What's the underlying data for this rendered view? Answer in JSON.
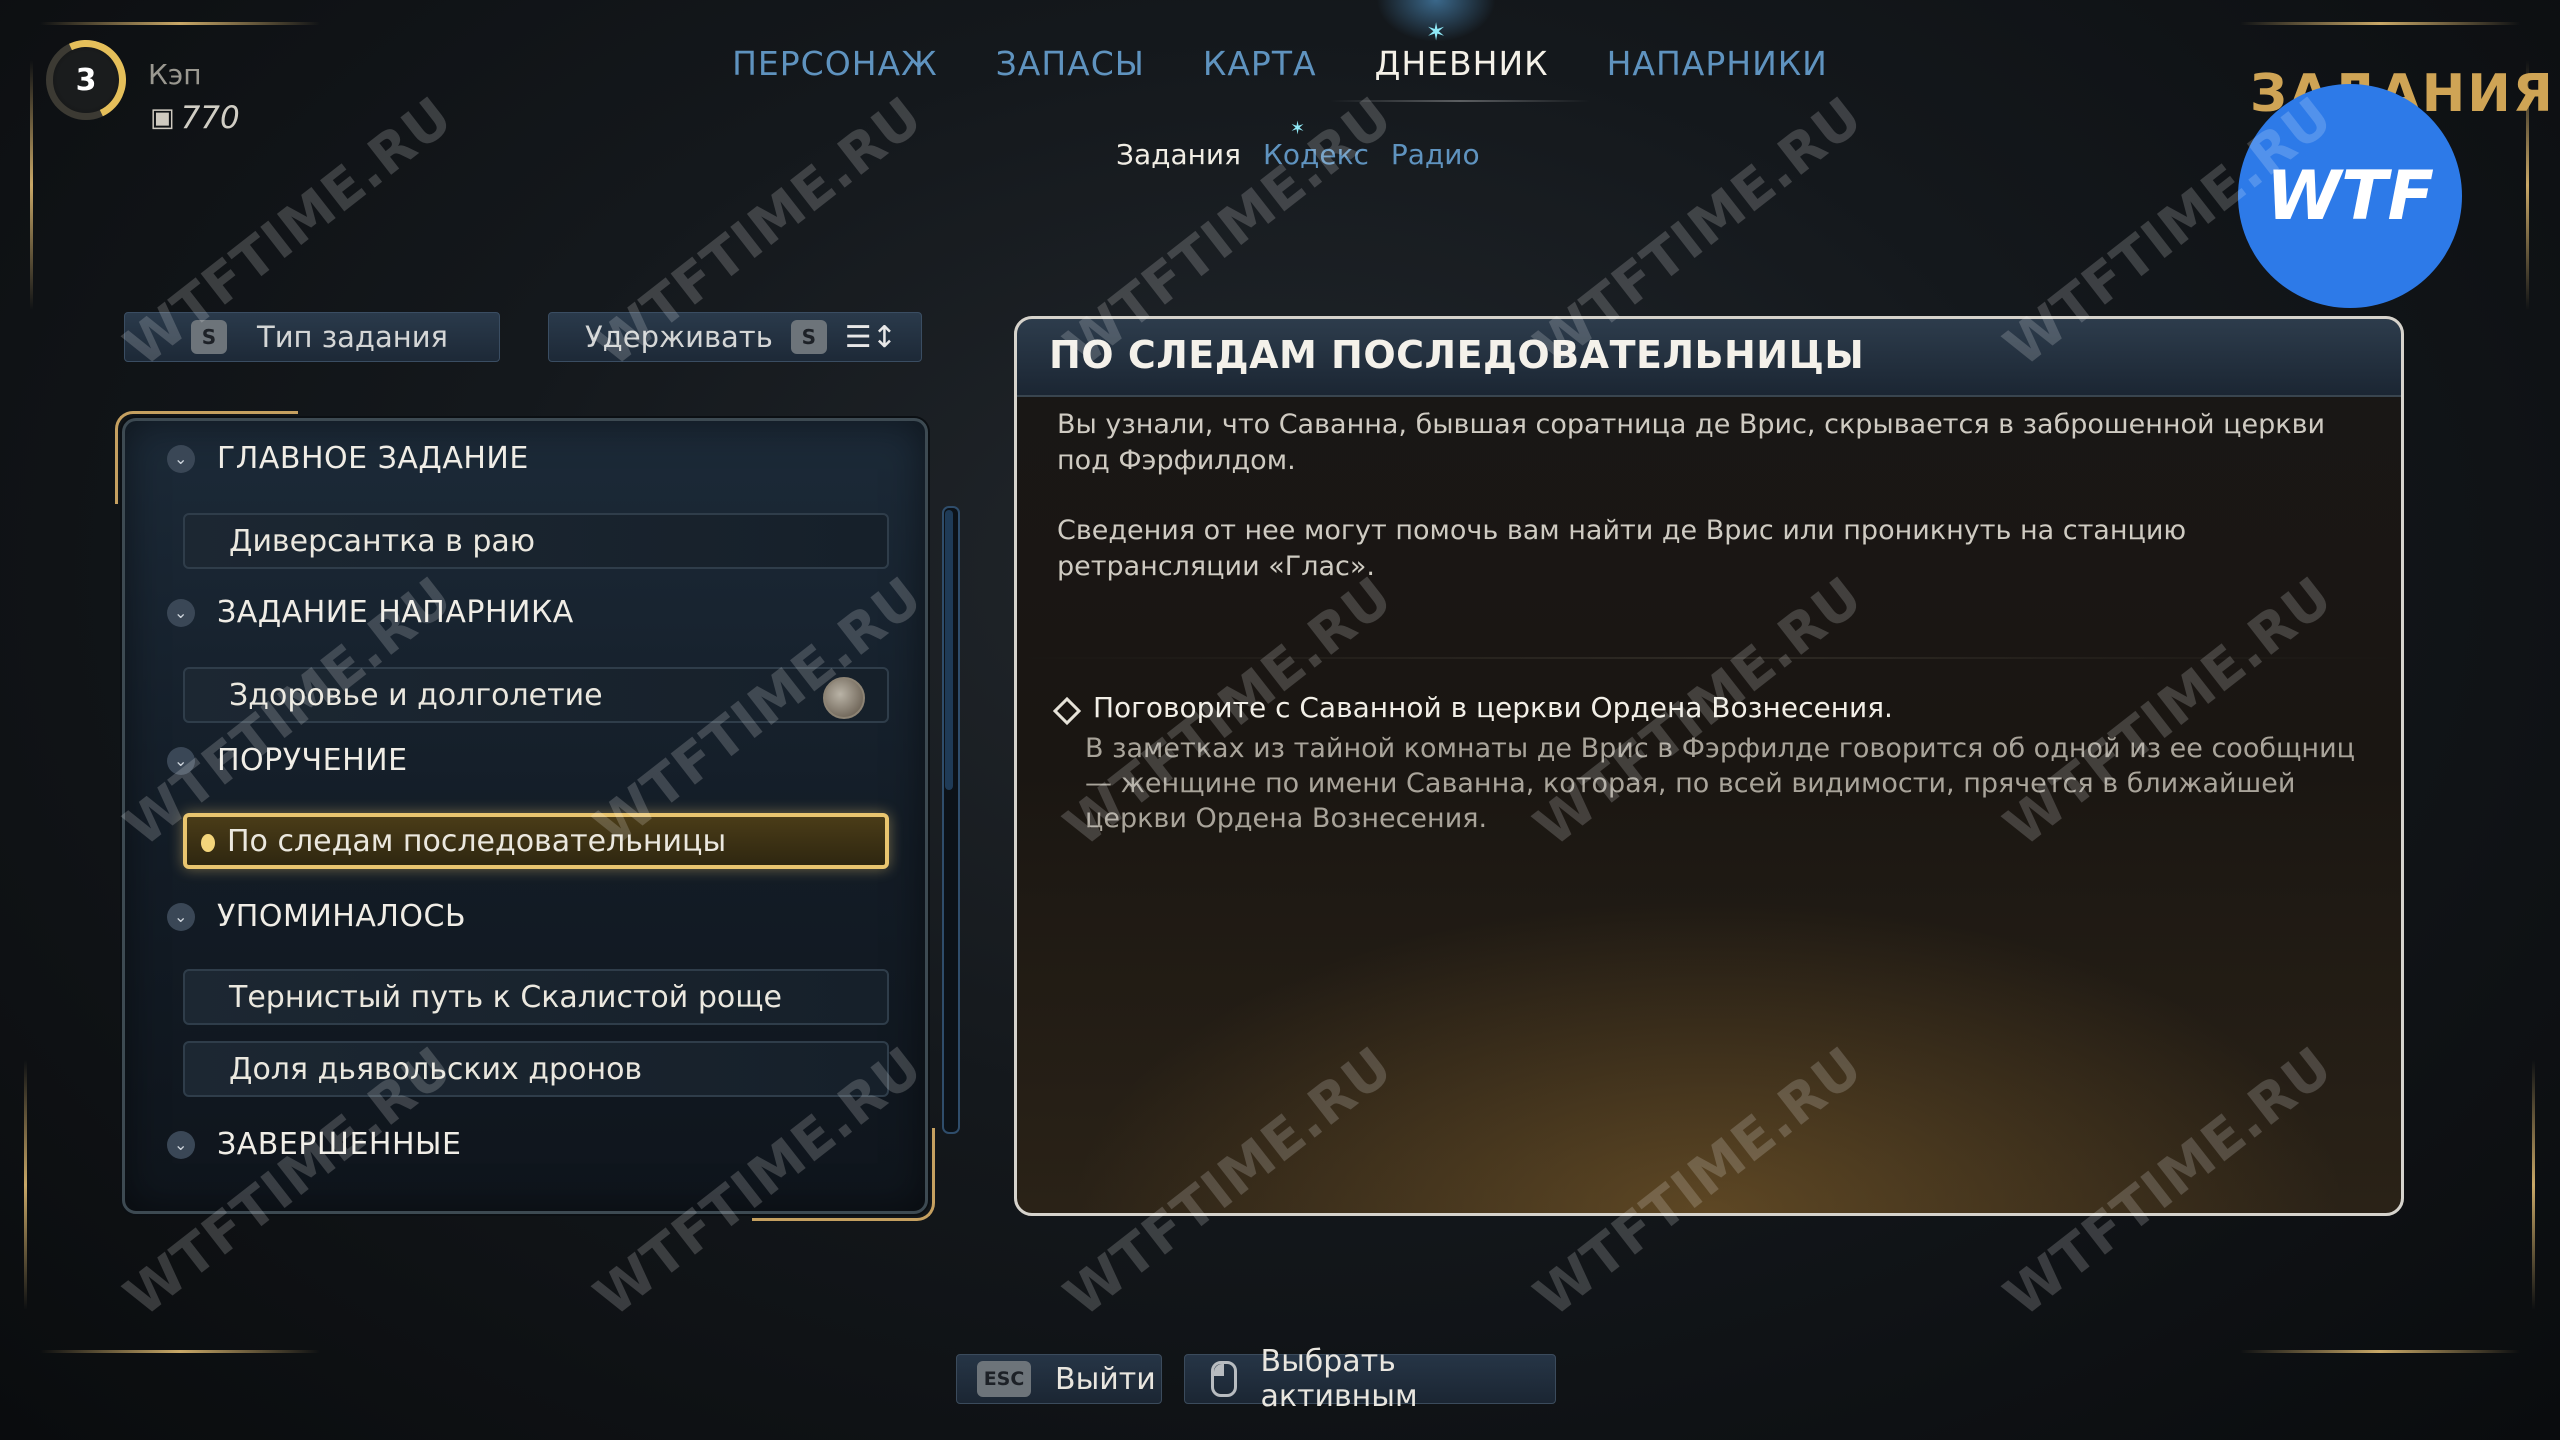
{
  "player": {
    "level": "3",
    "name": "Кэп",
    "currency_icon": "bits-icon",
    "currency": "770"
  },
  "nav": {
    "tabs": [
      {
        "label": "ПЕРСОНАЖ",
        "active": false
      },
      {
        "label": "ЗАПАСЫ",
        "active": false
      },
      {
        "label": "КАРТА",
        "active": false
      },
      {
        "label": "ДНЕВНИК",
        "active": true
      },
      {
        "label": "НАПАРНИКИ",
        "active": false
      }
    ],
    "subtabs": [
      {
        "label": "Задания",
        "active": true
      },
      {
        "label": "Кодекс",
        "active": false
      },
      {
        "label": "Радио",
        "active": false
      }
    ]
  },
  "section_title": "ЗАДАНИЯ",
  "logo": "WTF",
  "filters": {
    "type": {
      "key": "S",
      "label": "Тип задания"
    },
    "hold": {
      "label": "Удерживать",
      "key": "S",
      "icon": "sort-icon"
    }
  },
  "quest_list": {
    "categories": [
      {
        "label": "ГЛАВНОЕ ЗАДАНИЕ"
      },
      {
        "label": "ЗАДАНИЕ НАПАРНИКА"
      },
      {
        "label": "ПОРУЧЕНИЕ"
      },
      {
        "label": "УПОМИНАЛОСЬ"
      },
      {
        "label": "ЗАВЕРШЕННЫЕ"
      }
    ],
    "quests": [
      {
        "label": "Диверсантка в раю",
        "selected": false
      },
      {
        "label": "Здоровье и долголетие",
        "selected": false
      },
      {
        "label": "По следам последовательницы",
        "selected": true
      },
      {
        "label": "Тернистый путь к Скалистой роще",
        "selected": false
      },
      {
        "label": "Доля дьявольских дронов",
        "selected": false
      }
    ]
  },
  "detail": {
    "title": "ПО СЛЕДАМ ПОСЛЕДОВАТЕЛЬНИЦЫ",
    "description_1": "Вы узнали, что Саванна, бывшая соратница де Врис, скрывается в заброшенной церкви под Фэрфилдом.",
    "description_2": "Сведения от нее могут помочь вам найти де Врис или проникнуть на станцию ретрансляции «Глас».",
    "objective": "Поговорите с Саванной в церкви Ордена Вознесения.",
    "objective_note": "В заметках из тайной комнаты де Врис в Фэрфилде говорится об одной из ее сообщниц — женщине по имени Саванна, которая, по всей видимости, прячется в ближайшей церкви Ордена Вознесения."
  },
  "footer": {
    "exit": {
      "key": "ESC",
      "label": "Выйти"
    },
    "select_active": {
      "icon": "mouse-icon",
      "label": "Выбрать активным"
    }
  },
  "watermark": "WTFTIME.RU",
  "colors": {
    "accent_gold": "#e9c56f",
    "tab_blue": "#5f93bf",
    "logo_blue": "#2d7ae8"
  }
}
